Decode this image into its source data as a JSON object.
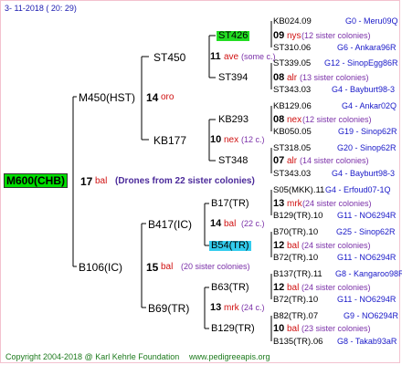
{
  "header": {
    "timestamp": "3- 11-2018 ( 20: 29)"
  },
  "footer": {
    "copyright": "Copyright 2004-2018 @ Karl Kehrle Foundation",
    "site": "www.pedigreeapis.org"
  },
  "root": {
    "label": "M600(CHB)",
    "gen_num": "17",
    "breed": "bal",
    "note": "(Drones from 22 sister colonies)"
  },
  "sire": {
    "label": "M450(HST)",
    "gen_num": "14",
    "breed": "oro"
  },
  "dam": {
    "label": "B106(IC)",
    "gen_num": "15",
    "breed": "bal",
    "note": "(20 sister colonies)"
  },
  "ss": {
    "label": "ST450",
    "gen_num": "11",
    "breed": "ave",
    "note": "(some c.)"
  },
  "sd": {
    "label": "KB177",
    "gen_num": "10",
    "breed": "nex",
    "note": "(12 c.)"
  },
  "ds": {
    "label": "B417(IC)",
    "gen_num": "14",
    "breed": "bal",
    "note": "(22 c.)"
  },
  "dd": {
    "label": "B69(TR)",
    "gen_num": "13",
    "breed": "mrk",
    "note": "(24 c.)"
  },
  "gg": [
    {
      "label": "ST426",
      "gen_num": "09",
      "breed": "nys",
      "note": "(12 sister colonies)"
    },
    {
      "label": "ST394",
      "gen_num": "08",
      "breed": "alr",
      "note": "(13 sister colonies)"
    },
    {
      "label": "KB293",
      "gen_num": "08",
      "breed": "nex",
      "note": "(12 sister colonies)"
    },
    {
      "label": "ST348",
      "gen_num": "07",
      "breed": "alr",
      "note": "(14 sister colonies)"
    },
    {
      "label": "B17(TR)",
      "gen_num": "13",
      "breed": "mrk",
      "note": "(24 sister colonies)"
    },
    {
      "label": "B54(TR)",
      "gen_num": "12",
      "breed": "bal",
      "note": "(24 sister colonies)"
    },
    {
      "label": "B63(TR)",
      "gen_num": "12",
      "breed": "bal",
      "note": "(24 sister colonies)"
    },
    {
      "label": "B129(TR)",
      "gen_num": "10",
      "breed": "bal",
      "note": "(23 sister colonies)"
    }
  ],
  "leaves": [
    {
      "id": "KB024.09",
      "loc": "G0 - Meru09Q"
    },
    {
      "id": "ST310.06",
      "loc": "G6 - Ankara96R"
    },
    {
      "id": "ST339.05",
      "loc": "G12 - SinopEgg86R"
    },
    {
      "id": "ST343.03",
      "loc": "G4 - Bayburt98-3"
    },
    {
      "id": "KB129.06",
      "loc": "G4 - Ankar02Q"
    },
    {
      "id": "KB050.05",
      "loc": "G19 - Sinop62R"
    },
    {
      "id": "ST318.05",
      "loc": "G20 - Sinop62R"
    },
    {
      "id": "ST343.03",
      "loc": "G4 - Bayburt98-3"
    },
    {
      "id": "S05(MKK).11",
      "loc": "G4 - Erfoud07-1Q"
    },
    {
      "id": "B129(TR).10",
      "loc": "G11 - NO6294R"
    },
    {
      "id": "B70(TR).10",
      "loc": "G25 - Sinop62R"
    },
    {
      "id": "B72(TR).10",
      "loc": "G11 - NO6294R"
    },
    {
      "id": "B137(TR).11",
      "loc": "G8 - Kangaroo98R"
    },
    {
      "id": "B72(TR).10",
      "loc": "G11 - NO6294R"
    },
    {
      "id": "B82(TR).07",
      "loc": "G9 - NO6294R"
    },
    {
      "id": "B135(TR).06",
      "loc": "G8 - Takab93aR"
    }
  ]
}
